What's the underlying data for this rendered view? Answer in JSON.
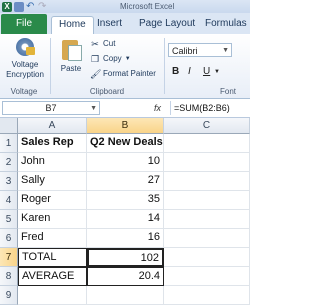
{
  "window": {
    "title": "Microsoft Excel"
  },
  "tabs": {
    "file": "File",
    "home": "Home",
    "insert": "Insert",
    "page_layout": "Page Layout",
    "formulas": "Formulas"
  },
  "ribbon": {
    "voltage": {
      "button_line1": "Voltage",
      "button_line2": "Encryption",
      "group_label": "Voltage"
    },
    "clipboard": {
      "paste": "Paste",
      "cut": "Cut",
      "copy": "Copy",
      "format_painter": "Format Painter",
      "group_label": "Clipboard"
    },
    "font": {
      "name": "Calibri",
      "bold": "B",
      "italic": "I",
      "underline": "U",
      "group_label": "Font"
    }
  },
  "formula_bar": {
    "name_box": "B7",
    "fx": "fx",
    "formula": "=SUM(B2:B6)"
  },
  "sheet": {
    "columns": [
      "A",
      "B",
      "C"
    ],
    "rows": [
      {
        "num": "1",
        "a": "Sales Rep",
        "b": "Q2 New Deals"
      },
      {
        "num": "2",
        "a": "John",
        "b": "10"
      },
      {
        "num": "3",
        "a": "Sally",
        "b": "27"
      },
      {
        "num": "4",
        "a": "Roger",
        "b": "35"
      },
      {
        "num": "5",
        "a": "Karen",
        "b": "14"
      },
      {
        "num": "6",
        "a": "Fred",
        "b": "16"
      },
      {
        "num": "7",
        "a": "TOTAL",
        "b": "102"
      },
      {
        "num": "8",
        "a": "AVERAGE",
        "b": "20.4"
      },
      {
        "num": "9",
        "a": "",
        "b": ""
      }
    ],
    "active_cell": "B7"
  }
}
